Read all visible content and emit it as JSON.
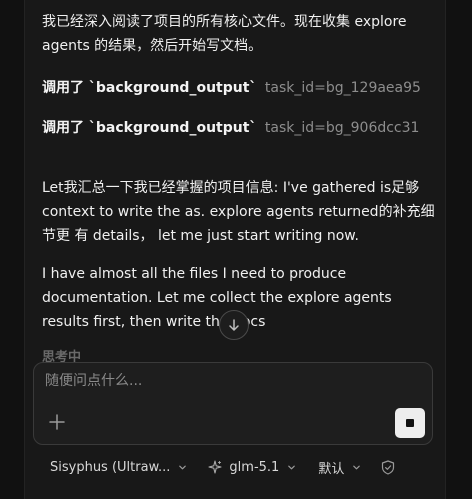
{
  "messages": {
    "intro": "我已经深入阅读了项目的所有核心文件。现在收集 explore agents 的结果，然后开始写文档。",
    "tool_calls": [
      {
        "verb": "调用了 `background_output`",
        "arg": "task_id=bg_129aea95"
      },
      {
        "verb": "调用了 `background_output`",
        "arg": "task_id=bg_906dcc31"
      }
    ],
    "summary": "Let我汇总一下我已经掌握的项目信息: I've gathered is足够 context to write the as. explore agents returned的补充细节更 有 details， let me just start writing now.",
    "plan": "I have almost all the files I need to produce documentation. Let me collect the explore agents results first, then write the docs",
    "status": "思考中"
  },
  "composer": {
    "placeholder": "随便问点什么..."
  },
  "toolbar": {
    "agent_label": "Sisyphus (Ultraw...",
    "model_label": "glm-5.1",
    "permission_label": "默认"
  },
  "icons": {
    "scroll": "arrow-down-icon",
    "add": "plus-icon",
    "stop": "stop-icon",
    "model": "sparkle-icon",
    "permission": "shield-check-icon"
  },
  "colors": {
    "background": "#111111",
    "panel": "#181818",
    "composer": "#1e1e1e",
    "muted_text": "#8d8d8d"
  }
}
